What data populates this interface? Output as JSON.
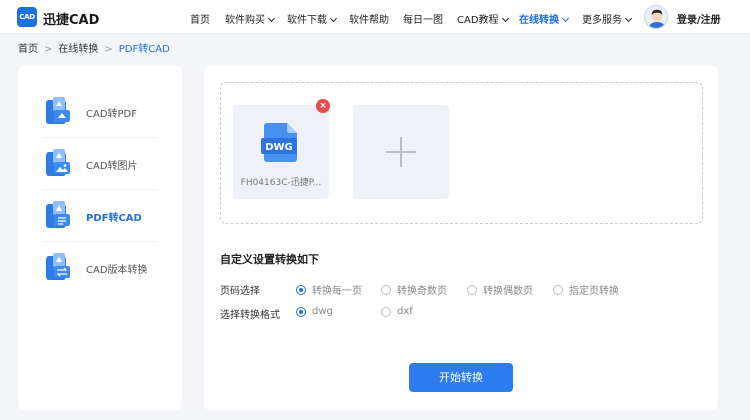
{
  "header": {
    "logo_text": "CAD",
    "brand": "迅捷CAD",
    "nav": [
      {
        "label": "首页",
        "caret": false
      },
      {
        "label": "软件购买",
        "caret": true
      },
      {
        "label": "软件下载",
        "caret": true
      },
      {
        "label": "软件帮助",
        "caret": false
      },
      {
        "label": "每日一图",
        "caret": false
      },
      {
        "label": "CAD教程",
        "caret": true
      },
      {
        "label": "在线转换",
        "caret": true,
        "active": true
      },
      {
        "label": "更多服务",
        "caret": true
      }
    ],
    "login": "登录/注册"
  },
  "breadcrumb": {
    "home": "首页",
    "section": "在线转换",
    "current": "PDF转CAD",
    "separator": ">"
  },
  "sidebar": {
    "items": [
      {
        "label": "CAD转PDF",
        "icon": "cad-to-pdf-icon"
      },
      {
        "label": "CAD转图片",
        "icon": "cad-to-image-icon"
      },
      {
        "label": "PDF转CAD",
        "icon": "pdf-to-cad-icon",
        "active": true
      },
      {
        "label": "CAD版本转换",
        "icon": "cad-version-icon"
      }
    ]
  },
  "upload": {
    "file_badge": "DWG",
    "file_name": "FH04163C-迅捷P...",
    "remove_glyph": "×"
  },
  "settings": {
    "title": "自定义设置转换如下",
    "page_label": "页码选择",
    "page_options": [
      "转换每一页",
      "转换奇数页",
      "转换偶数页",
      "指定页转换"
    ],
    "page_selected": 0,
    "format_label": "选择转换格式",
    "format_options": [
      "dwg",
      "dxf"
    ],
    "format_selected": 0
  },
  "start_button": "开始转换",
  "colors": {
    "accent": "#1f6fe5",
    "button": "#2c7cf0",
    "remove": "#e74c4c"
  }
}
